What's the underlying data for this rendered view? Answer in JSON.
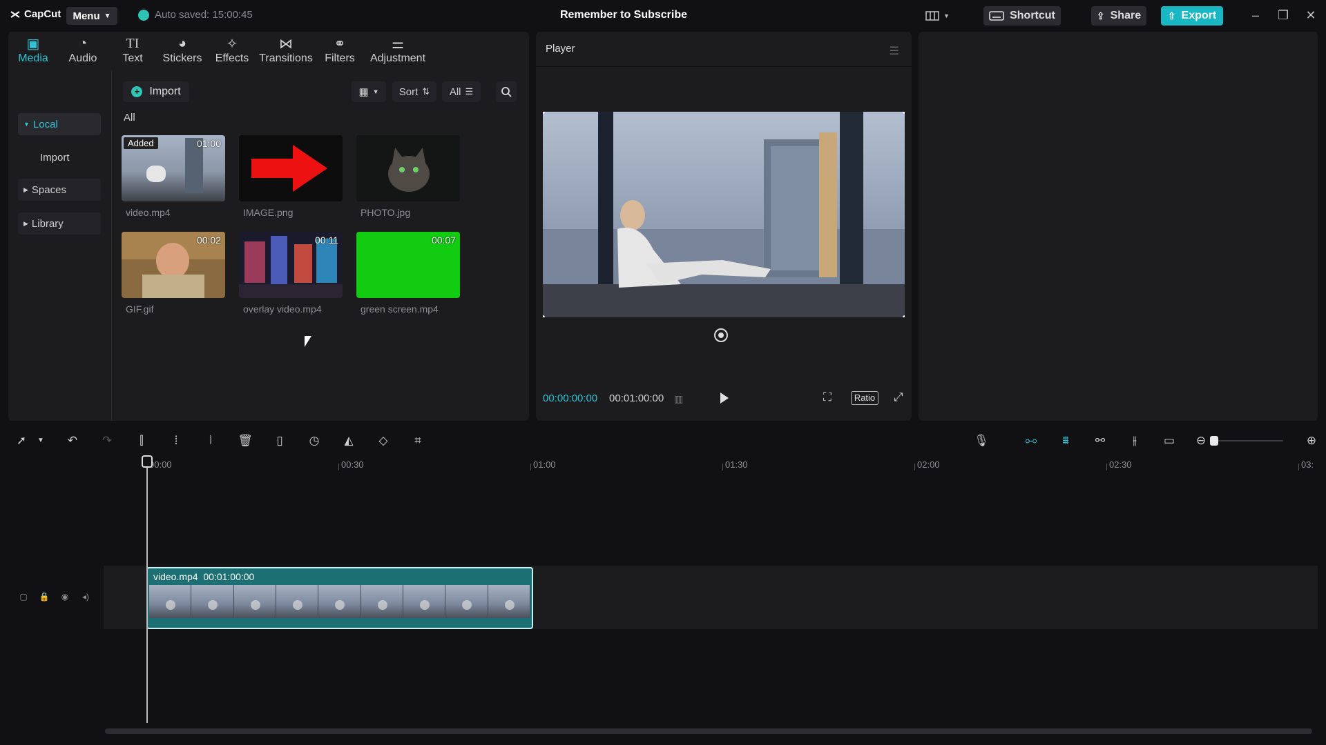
{
  "app": {
    "logo_text": "CapCut",
    "menu_label": "Menu",
    "autosave_text": "Auto saved: 15:00:45",
    "project_title": "Remember to Subscribe",
    "shortcut_label": "Shortcut",
    "share_label": "Share",
    "export_label": "Export",
    "accent_color": "#2ec4d4"
  },
  "media_tabs": [
    {
      "label": "Media",
      "icon": "media-icon",
      "active": true
    },
    {
      "label": "Audio",
      "icon": "audio-icon"
    },
    {
      "label": "Text",
      "icon": "text-icon"
    },
    {
      "label": "Stickers",
      "icon": "stickers-icon"
    },
    {
      "label": "Effects",
      "icon": "effects-icon"
    },
    {
      "label": "Transitions",
      "icon": "transitions-icon"
    },
    {
      "label": "Filters",
      "icon": "filters-icon"
    },
    {
      "label": "Adjustment",
      "icon": "adjustment-icon"
    }
  ],
  "sidebar": {
    "local": "Local",
    "import": "Import",
    "spaces": "Spaces",
    "library": "Library"
  },
  "media_toolbar": {
    "import_label": "Import",
    "sort_label": "Sort",
    "filter_all": "All"
  },
  "media_section_label": "All",
  "media_items": [
    {
      "name": "video.mp4",
      "badge": "Added",
      "duration": "01:00"
    },
    {
      "name": "IMAGE.png",
      "duration": ""
    },
    {
      "name": "PHOTO.jpg",
      "duration": ""
    },
    {
      "name": "GIF.gif",
      "duration": "00:02"
    },
    {
      "name": "overlay video.mp4",
      "duration": "00:11"
    },
    {
      "name": "green screen.mp4",
      "duration": "00:07"
    }
  ],
  "player": {
    "title": "Player",
    "current_time": "00:00:00:00",
    "total_time": "00:01:00:00",
    "ratio_label": "Ratio"
  },
  "timeline": {
    "ticks": [
      "00:00",
      "00:30",
      "01:00",
      "01:30",
      "02:00",
      "02:30",
      "03:"
    ],
    "clip_name": "video.mp4",
    "clip_duration": "00:01:00:00"
  }
}
